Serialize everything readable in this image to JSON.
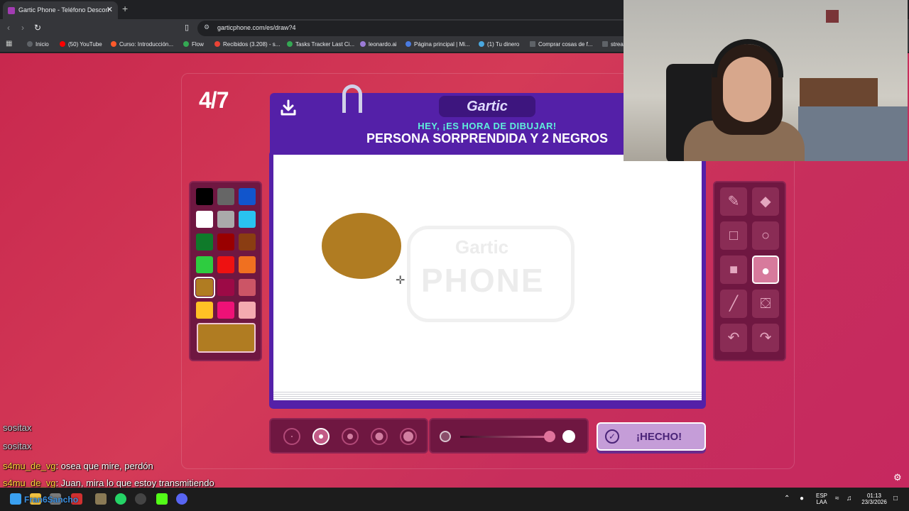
{
  "browser": {
    "tab_title": "Gartic Phone - Teléfono Descon",
    "tab_close": "✕",
    "new_tab": "+",
    "url": "garticphone.com/es/draw?4",
    "bookmarks": [
      {
        "label": "Inicio",
        "color": "#5f6368"
      },
      {
        "label": "(50) YouTube",
        "color": "#ff0000"
      },
      {
        "label": "Curso: Introducción...",
        "color": "#ff5a2b"
      },
      {
        "label": "Flow",
        "color": "#34a853"
      },
      {
        "label": "Recibidos (3.208) - s...",
        "color": "#ea4335"
      },
      {
        "label": "Tasks Tracker Last Ci...",
        "color": "#34a853"
      },
      {
        "label": "leonardo.ai",
        "color": "#9b7bd6"
      },
      {
        "label": "Página principal | Mi...",
        "color": "#4a7be0"
      },
      {
        "label": "(1) Tu dinero",
        "color": "#4aa8e0"
      },
      {
        "label": "Comprar cosas de f...",
        "color": "#5f6368"
      },
      {
        "label": "strea",
        "color": "#5f6368"
      }
    ]
  },
  "game": {
    "round": "4/7",
    "logo": "Gartic",
    "subtitle": "HEY, ¡ES HORA DE DIBUJAR!",
    "prompt": "PERSONA SORPRENDIDA Y 2 NEGROS",
    "watermark_top": "Gartic",
    "watermark_bottom": "PHONE",
    "done_label": "¡HECHO!",
    "selected_color": "#b07c22",
    "palette": [
      "#000000",
      "#666666",
      "#1155cc",
      "#ffffff",
      "#aaaaaa",
      "#29c3f0",
      "#0f7a2a",
      "#990000",
      "#8a3d12",
      "#2ecc40",
      "#ee1111",
      "#f07020",
      "#b07c22",
      "#9c0a46",
      "#cc5566",
      "#ffc125",
      "#ee1177",
      "#f4aab0"
    ],
    "tools": [
      "pencil-icon",
      "eraser-icon",
      "rectangle-outline-icon",
      "ellipse-outline-icon",
      "rectangle-fill-icon",
      "ellipse-fill-icon",
      "line-icon",
      "bucket-icon",
      "undo-icon",
      "redo-icon"
    ],
    "active_tool": "ellipse-fill-icon",
    "brush_sizes_selected": 2,
    "opacity_level": 0.9
  },
  "chat": [
    {
      "user": "sositax",
      "text": ""
    },
    {
      "user": "sositax",
      "text": ""
    },
    {
      "user": "s4mu_de_vg",
      "text": ": osea que mire, perdón"
    },
    {
      "user": "s4mu_de_vg",
      "text": ": Juan, mira lo que estoy transmitiendo"
    }
  ],
  "taskbar": {
    "lang": "ESP",
    "lang2": "LAA",
    "time": "01:13",
    "date": "23/3/2026",
    "overlay_name": "Fran6Sancho"
  }
}
